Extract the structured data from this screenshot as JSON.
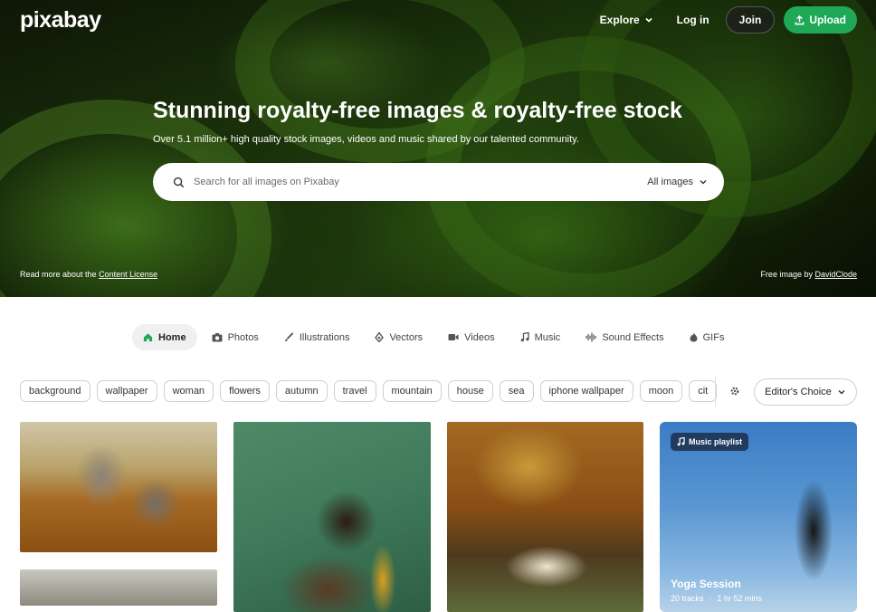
{
  "brand": {
    "logo": "pixabay"
  },
  "nav": {
    "explore": "Explore",
    "login": "Log in",
    "join": "Join",
    "upload": "Upload"
  },
  "hero": {
    "title": "Stunning royalty-free images & royalty-free stock",
    "subtitle": "Over 5.1 million+ high quality stock images, videos and music shared by our talented community.",
    "license_prefix": "Read more about the ",
    "license_link": "Content License",
    "credit_prefix": "Free image by ",
    "credit_author": "DavidClode"
  },
  "search": {
    "placeholder": "Search for all images on Pixabay",
    "type_selected": "All images"
  },
  "tabs": [
    "Home",
    "Photos",
    "Illustrations",
    "Vectors",
    "Videos",
    "Music",
    "Sound Effects",
    "GIFs"
  ],
  "tags": [
    "background",
    "wallpaper",
    "woman",
    "flowers",
    "autumn",
    "travel",
    "mountain",
    "house",
    "sea",
    "iphone wallpaper",
    "moon",
    "cit"
  ],
  "filter": {
    "editors_choice": "Editor's Choice"
  },
  "playlist": {
    "badge": "Music playlist",
    "title": "Yoga Session",
    "tracks": "20 tracks",
    "duration": "1 hr 52 mins"
  },
  "colors": {
    "accent": "#1fa957",
    "tab_active_bg": "#f0f0f0"
  },
  "icons": [
    "chevron-down-icon",
    "upload-icon",
    "search-icon",
    "home-icon",
    "camera-icon",
    "brush-icon",
    "vector-icon",
    "video-icon",
    "music-icon",
    "waveform-icon",
    "gif-icon",
    "gear-icon"
  ]
}
